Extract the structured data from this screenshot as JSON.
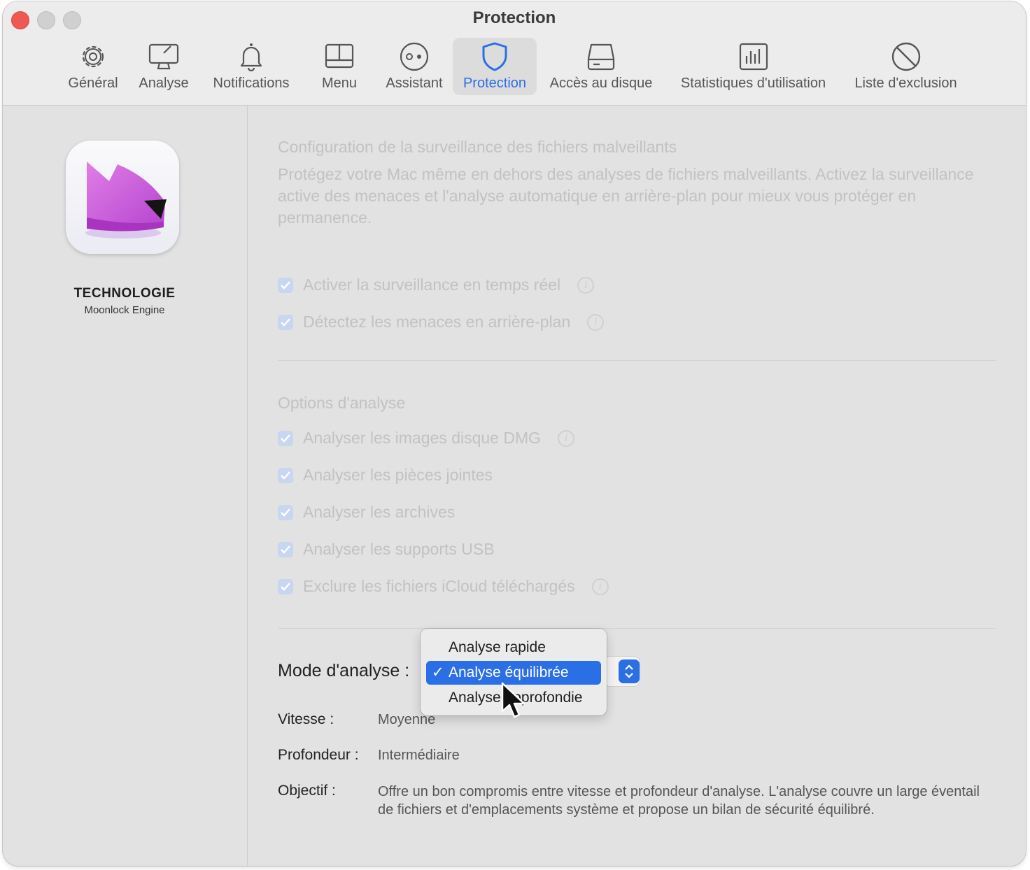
{
  "window": {
    "title": "Protection"
  },
  "toolbar": {
    "tabs": [
      {
        "label": "Général",
        "icon": "gear-icon"
      },
      {
        "label": "Analyse",
        "icon": "monitor-scan-icon"
      },
      {
        "label": "Notifications",
        "icon": "bell-icon"
      },
      {
        "label": "Menu",
        "icon": "menu-bar-icon"
      },
      {
        "label": "Assistant",
        "icon": "assistant-icon"
      },
      {
        "label": "Protection",
        "icon": "shield-icon",
        "active": true
      },
      {
        "label": "Accès au disque",
        "icon": "disk-icon"
      },
      {
        "label": "Statistiques d'utilisation",
        "icon": "stats-icon"
      },
      {
        "label": "Liste d'exclusion",
        "icon": "prohibited-icon"
      }
    ]
  },
  "sidebar": {
    "title": "TECHNOLOGIE",
    "subtitle": "Moonlock Engine"
  },
  "monitoring": {
    "heading": "Configuration de la surveillance des fichiers malveillants",
    "description": "Protégez votre Mac même en dehors des analyses de fichiers malveillants. Activez la surveillance active des menaces et l'analyse automatique en arrière-plan pour mieux vous protéger en permanence.",
    "options": [
      {
        "label": "Activer la surveillance en temps réel",
        "checked": true,
        "info": true
      },
      {
        "label": "Détectez les menaces en arrière-plan",
        "checked": true,
        "info": true
      }
    ]
  },
  "scan_options": {
    "heading": "Options d'analyse",
    "options": [
      {
        "label": "Analyser les images disque DMG",
        "checked": true,
        "info": true
      },
      {
        "label": "Analyser les pièces jointes",
        "checked": true,
        "info": false
      },
      {
        "label": "Analyser les archives",
        "checked": true,
        "info": false
      },
      {
        "label": "Analyser les supports USB",
        "checked": true,
        "info": false
      },
      {
        "label": "Exclure les fichiers iCloud téléchargés",
        "checked": true,
        "info": true
      }
    ]
  },
  "scan_mode": {
    "label": "Mode d'analyse :",
    "dropdown": [
      {
        "label": "Analyse rapide",
        "selected": false
      },
      {
        "label": "Analyse équilibrée",
        "selected": true
      },
      {
        "label": "Analyse approfondie",
        "selected": false
      }
    ],
    "check_glyph": "✓",
    "speed_label": "Vitesse :",
    "speed_value": "Moyenne",
    "depth_label": "Profondeur :",
    "depth_value": "Intermédiaire",
    "objective_label": "Objectif :",
    "objective_value": "Offre un bon compromis entre vitesse et profondeur d'analyse. L'analyse couvre un large éventail de fichiers et d'emplacements système et propose un bilan de sécurité équilibré."
  },
  "colors": {
    "accent": "#2b6fe6",
    "close": "#ee5a52",
    "muted_text": "#c2c2c2"
  }
}
